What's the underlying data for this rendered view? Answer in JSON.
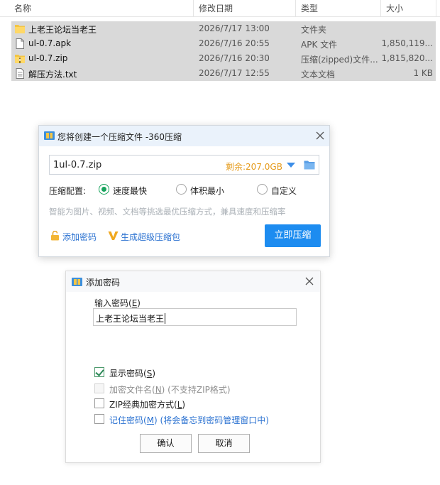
{
  "explorer": {
    "columns": {
      "name": "名称",
      "date": "修改日期",
      "type": "类型",
      "size": "大小"
    },
    "files": [
      {
        "name": "上老王论坛当老王",
        "date": "2026/7/17 13:00",
        "type": "文件夹",
        "size": "",
        "icon": "folder-icon"
      },
      {
        "name": "ul-0.7.apk",
        "date": "2026/7/16 20:55",
        "type": "APK 文件",
        "size": "1,850,119...",
        "icon": "file-icon"
      },
      {
        "name": "ul-0.7.zip",
        "date": "2026/7/16 20:30",
        "type": "压缩(zipped)文件...",
        "size": "1,815,820...",
        "icon": "zip-folder-icon"
      },
      {
        "name": "解压方法.txt",
        "date": "2026/7/17 12:55",
        "type": "文本文档",
        "size": "1 KB",
        "icon": "text-file-icon"
      }
    ]
  },
  "compress_dialog": {
    "title": "您将创建一个压缩文件 -360压缩",
    "path": "1ul-0.7.zip",
    "free_space": "剩余:207.0GB",
    "config_label": "压缩配置:",
    "options": [
      {
        "label": "速度最快",
        "selected": true
      },
      {
        "label": "体积最小",
        "selected": false
      },
      {
        "label": "自定义",
        "selected": false
      }
    ],
    "hint": "智能为图片、视频、文档等挑选最优压缩方式，兼具速度和压缩率",
    "add_password_link": "添加密码",
    "super_compress_link": "生成超级压缩包",
    "compress_now_button": "立即压缩",
    "accent_color": "#1d8cf0"
  },
  "password_dialog": {
    "title": "添加密码",
    "input_label": "输入密码(",
    "input_label_key": "E",
    "input_label_end": ")",
    "password_value": "上老王论坛当老王",
    "show_password": {
      "text": "显示密码(",
      "key": "S",
      "end": ")",
      "checked": true
    },
    "encrypt_filenames": {
      "text": "加密文件名(",
      "key": "N",
      "end": ") (不支持ZIP格式)",
      "checked": false,
      "disabled": true
    },
    "zip_classic": {
      "text": "ZIP经典加密方式(",
      "key": "L",
      "end": ")",
      "checked": false
    },
    "remember_password": {
      "text": "记住密码(",
      "key": "M",
      "end": ") (将会备忘到密码管理窗口中)",
      "checked": false
    },
    "ok_button": "确认",
    "cancel_button": "取消"
  }
}
